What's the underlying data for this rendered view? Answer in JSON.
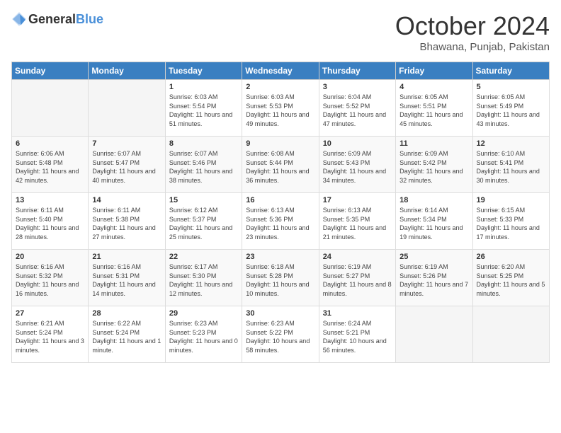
{
  "header": {
    "logo": {
      "general": "General",
      "blue": "Blue"
    },
    "title": "October 2024",
    "location": "Bhawana, Punjab, Pakistan"
  },
  "days_of_week": [
    "Sunday",
    "Monday",
    "Tuesday",
    "Wednesday",
    "Thursday",
    "Friday",
    "Saturday"
  ],
  "weeks": [
    [
      {
        "day": "",
        "info": ""
      },
      {
        "day": "",
        "info": ""
      },
      {
        "day": "1",
        "sunrise": "Sunrise: 6:03 AM",
        "sunset": "Sunset: 5:54 PM",
        "daylight": "Daylight: 11 hours and 51 minutes."
      },
      {
        "day": "2",
        "sunrise": "Sunrise: 6:03 AM",
        "sunset": "Sunset: 5:53 PM",
        "daylight": "Daylight: 11 hours and 49 minutes."
      },
      {
        "day": "3",
        "sunrise": "Sunrise: 6:04 AM",
        "sunset": "Sunset: 5:52 PM",
        "daylight": "Daylight: 11 hours and 47 minutes."
      },
      {
        "day": "4",
        "sunrise": "Sunrise: 6:05 AM",
        "sunset": "Sunset: 5:51 PM",
        "daylight": "Daylight: 11 hours and 45 minutes."
      },
      {
        "day": "5",
        "sunrise": "Sunrise: 6:05 AM",
        "sunset": "Sunset: 5:49 PM",
        "daylight": "Daylight: 11 hours and 43 minutes."
      }
    ],
    [
      {
        "day": "6",
        "sunrise": "Sunrise: 6:06 AM",
        "sunset": "Sunset: 5:48 PM",
        "daylight": "Daylight: 11 hours and 42 minutes."
      },
      {
        "day": "7",
        "sunrise": "Sunrise: 6:07 AM",
        "sunset": "Sunset: 5:47 PM",
        "daylight": "Daylight: 11 hours and 40 minutes."
      },
      {
        "day": "8",
        "sunrise": "Sunrise: 6:07 AM",
        "sunset": "Sunset: 5:46 PM",
        "daylight": "Daylight: 11 hours and 38 minutes."
      },
      {
        "day": "9",
        "sunrise": "Sunrise: 6:08 AM",
        "sunset": "Sunset: 5:44 PM",
        "daylight": "Daylight: 11 hours and 36 minutes."
      },
      {
        "day": "10",
        "sunrise": "Sunrise: 6:09 AM",
        "sunset": "Sunset: 5:43 PM",
        "daylight": "Daylight: 11 hours and 34 minutes."
      },
      {
        "day": "11",
        "sunrise": "Sunrise: 6:09 AM",
        "sunset": "Sunset: 5:42 PM",
        "daylight": "Daylight: 11 hours and 32 minutes."
      },
      {
        "day": "12",
        "sunrise": "Sunrise: 6:10 AM",
        "sunset": "Sunset: 5:41 PM",
        "daylight": "Daylight: 11 hours and 30 minutes."
      }
    ],
    [
      {
        "day": "13",
        "sunrise": "Sunrise: 6:11 AM",
        "sunset": "Sunset: 5:40 PM",
        "daylight": "Daylight: 11 hours and 28 minutes."
      },
      {
        "day": "14",
        "sunrise": "Sunrise: 6:11 AM",
        "sunset": "Sunset: 5:38 PM",
        "daylight": "Daylight: 11 hours and 27 minutes."
      },
      {
        "day": "15",
        "sunrise": "Sunrise: 6:12 AM",
        "sunset": "Sunset: 5:37 PM",
        "daylight": "Daylight: 11 hours and 25 minutes."
      },
      {
        "day": "16",
        "sunrise": "Sunrise: 6:13 AM",
        "sunset": "Sunset: 5:36 PM",
        "daylight": "Daylight: 11 hours and 23 minutes."
      },
      {
        "day": "17",
        "sunrise": "Sunrise: 6:13 AM",
        "sunset": "Sunset: 5:35 PM",
        "daylight": "Daylight: 11 hours and 21 minutes."
      },
      {
        "day": "18",
        "sunrise": "Sunrise: 6:14 AM",
        "sunset": "Sunset: 5:34 PM",
        "daylight": "Daylight: 11 hours and 19 minutes."
      },
      {
        "day": "19",
        "sunrise": "Sunrise: 6:15 AM",
        "sunset": "Sunset: 5:33 PM",
        "daylight": "Daylight: 11 hours and 17 minutes."
      }
    ],
    [
      {
        "day": "20",
        "sunrise": "Sunrise: 6:16 AM",
        "sunset": "Sunset: 5:32 PM",
        "daylight": "Daylight: 11 hours and 16 minutes."
      },
      {
        "day": "21",
        "sunrise": "Sunrise: 6:16 AM",
        "sunset": "Sunset: 5:31 PM",
        "daylight": "Daylight: 11 hours and 14 minutes."
      },
      {
        "day": "22",
        "sunrise": "Sunrise: 6:17 AM",
        "sunset": "Sunset: 5:30 PM",
        "daylight": "Daylight: 11 hours and 12 minutes."
      },
      {
        "day": "23",
        "sunrise": "Sunrise: 6:18 AM",
        "sunset": "Sunset: 5:28 PM",
        "daylight": "Daylight: 11 hours and 10 minutes."
      },
      {
        "day": "24",
        "sunrise": "Sunrise: 6:19 AM",
        "sunset": "Sunset: 5:27 PM",
        "daylight": "Daylight: 11 hours and 8 minutes."
      },
      {
        "day": "25",
        "sunrise": "Sunrise: 6:19 AM",
        "sunset": "Sunset: 5:26 PM",
        "daylight": "Daylight: 11 hours and 7 minutes."
      },
      {
        "day": "26",
        "sunrise": "Sunrise: 6:20 AM",
        "sunset": "Sunset: 5:25 PM",
        "daylight": "Daylight: 11 hours and 5 minutes."
      }
    ],
    [
      {
        "day": "27",
        "sunrise": "Sunrise: 6:21 AM",
        "sunset": "Sunset: 5:24 PM",
        "daylight": "Daylight: 11 hours and 3 minutes."
      },
      {
        "day": "28",
        "sunrise": "Sunrise: 6:22 AM",
        "sunset": "Sunset: 5:24 PM",
        "daylight": "Daylight: 11 hours and 1 minute."
      },
      {
        "day": "29",
        "sunrise": "Sunrise: 6:23 AM",
        "sunset": "Sunset: 5:23 PM",
        "daylight": "Daylight: 11 hours and 0 minutes."
      },
      {
        "day": "30",
        "sunrise": "Sunrise: 6:23 AM",
        "sunset": "Sunset: 5:22 PM",
        "daylight": "Daylight: 10 hours and 58 minutes."
      },
      {
        "day": "31",
        "sunrise": "Sunrise: 6:24 AM",
        "sunset": "Sunset: 5:21 PM",
        "daylight": "Daylight: 10 hours and 56 minutes."
      },
      {
        "day": "",
        "info": ""
      },
      {
        "day": "",
        "info": ""
      }
    ]
  ]
}
